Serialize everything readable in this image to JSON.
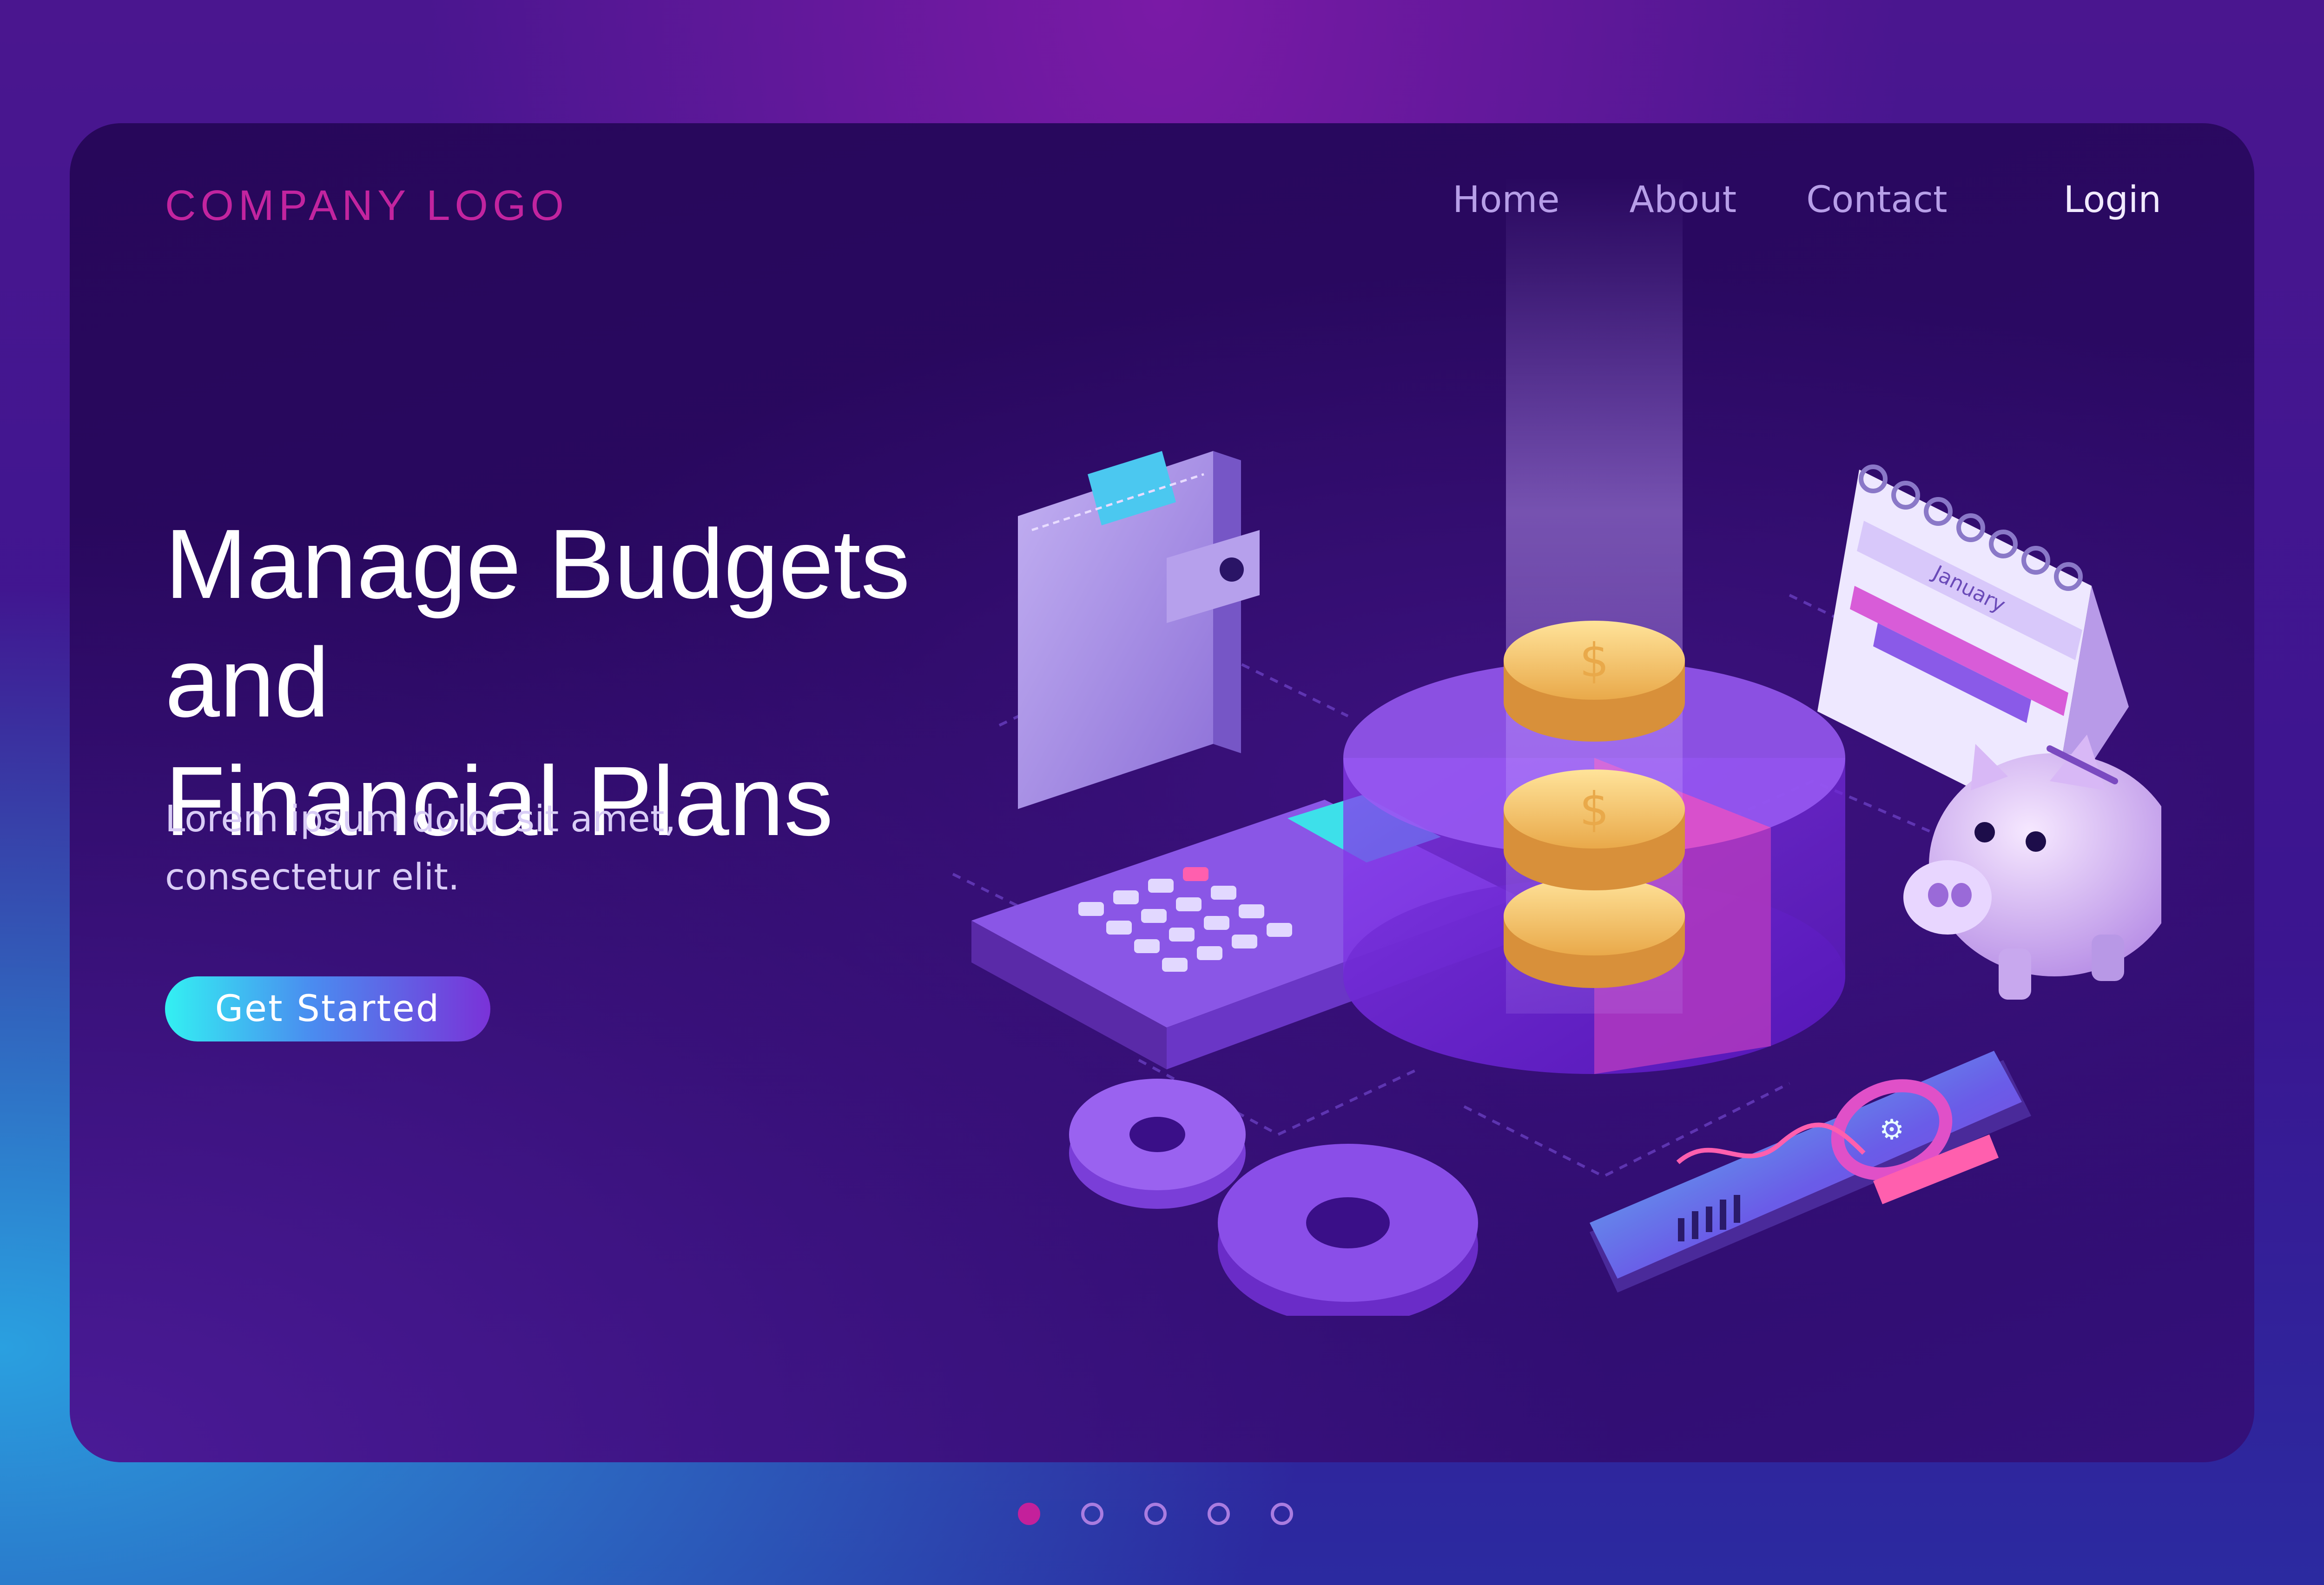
{
  "header": {
    "logo_text": "COMPANY LOGO",
    "nav": [
      {
        "label": "Home"
      },
      {
        "label": "About"
      },
      {
        "label": "Contact"
      }
    ],
    "login_label": "Login"
  },
  "hero": {
    "title_line1": "Manage Budgets and",
    "title_line2": "Financial Plans",
    "subtitle_line1": "Lorem ipsum dolor sit amet,",
    "subtitle_line2": "consectetur elit.",
    "cta_label": "Get Started"
  },
  "illustration": {
    "coin_symbol": "$",
    "calendar_month": "January",
    "items": [
      "wallet-icon",
      "calculator-icon",
      "pie-chart-icon",
      "coin-stack-icon",
      "calendar-icon",
      "piggy-bank-icon",
      "gears-icon",
      "smartphone-icon"
    ]
  },
  "pagination": {
    "count": 5,
    "active_index": 0
  },
  "colors": {
    "accent_magenta": "#c2249f",
    "cta_start": "#33f0f2",
    "cta_end": "#7a32d8",
    "card_bg": "#27075a",
    "coin_gold": "#f2c461"
  }
}
